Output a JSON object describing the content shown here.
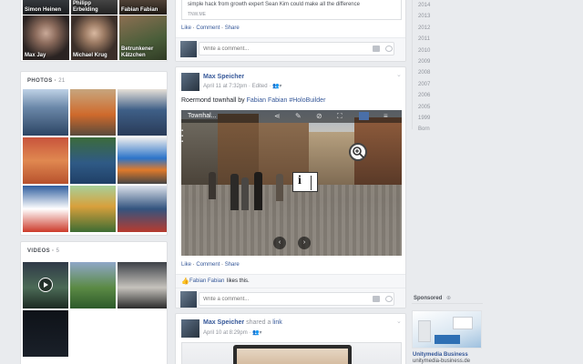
{
  "friends": {
    "top_captions": [
      "Simon Heinen",
      "Philipp Erbelding",
      "Fabian Fabian"
    ],
    "bottom_captions": [
      "Max Jay",
      "Michael Krug",
      "Betrunkener Kätzchen"
    ]
  },
  "photos": {
    "title": "PHOTOS",
    "count": "21"
  },
  "videos": {
    "title": "VIDEOS",
    "count": "5"
  },
  "post0": {
    "text_tail": "simple hack from growth expert Sean Kim could make all the difference",
    "link_domain": "TNW.ME",
    "actions": [
      "Like",
      "Comment",
      "Share"
    ],
    "comment_placeholder": "Write a comment..."
  },
  "post1": {
    "author": "Max Speicher",
    "date": "April 11 at 7:32pm",
    "edited": "Edited",
    "text_prefix": "Roermond townhall by",
    "mention": "Fabian Fabian",
    "hashtag": "#HoloBuilder",
    "embed_title": "Townhal...",
    "actions": [
      "Like",
      "Comment",
      "Share"
    ],
    "likers": "Fabian Fabian",
    "likes_suffix": "likes this.",
    "comment_placeholder": "Write a comment..."
  },
  "post2": {
    "author": "Max Speicher",
    "action_text": "shared a",
    "action_link": "link",
    "date": "April 10 at 8:29pm"
  },
  "timeline_years": [
    "2014",
    "2013",
    "2012",
    "2011",
    "2010",
    "2009",
    "2008",
    "2007",
    "2006",
    "2005",
    "1999",
    "Born"
  ],
  "sponsored": {
    "label": "Sponsored",
    "ad_title": "Unitymedia Business",
    "ad_domain": "unitymedia-business.de"
  },
  "colors": {
    "link": "#365899",
    "muted": "#90949c",
    "background": "#e9ebee"
  }
}
